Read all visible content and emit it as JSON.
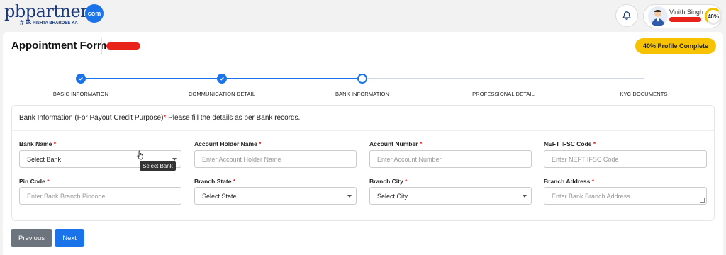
{
  "topbar": {
    "logo_text": "pbpartners",
    "logo_com": "com",
    "logo_tagline": "EK RISHTA BHAROSE KA",
    "user_name": "Vinith Singh",
    "profile_percent": "40%"
  },
  "header": {
    "title": "Appointment Form",
    "profile_complete": "40% Profile Complete"
  },
  "stepper": {
    "steps": [
      {
        "label": "BASIC INFORMATION",
        "state": "done"
      },
      {
        "label": "COMMUNICATION DETAIL",
        "state": "done"
      },
      {
        "label": "BANK INFORMATION",
        "state": "current"
      },
      {
        "label": "PROFESSIONAL DETAIL",
        "state": "pending"
      },
      {
        "label": "KYC DOCUMENTS",
        "state": "pending"
      }
    ]
  },
  "section": {
    "title": "Bank Information (For Payout Credit Purpose)",
    "required_mark": "*",
    "note": " Please fill the details as per Bank records."
  },
  "fields": {
    "bank_name": {
      "label": "Bank Name",
      "value": "Select Bank"
    },
    "account_holder": {
      "label": "Account Holder Name",
      "placeholder": "Enter Account Holder Name"
    },
    "account_number": {
      "label": "Account Number",
      "placeholder": "Enter Account Number"
    },
    "ifsc": {
      "label": "NEFT IFSC Code",
      "placeholder": "Enter NEFT IFSC Code"
    },
    "pin_code": {
      "label": "Pin Code",
      "placeholder": "Enter Bank Branch Pincode"
    },
    "branch_state": {
      "label": "Branch State",
      "value": "Select State"
    },
    "branch_city": {
      "label": "Branch City",
      "value": "Select City"
    },
    "branch_address": {
      "label": "Branch Address",
      "placeholder": "Enter Bank Branch Address"
    }
  },
  "tooltip": "Select Bank",
  "buttons": {
    "previous": "Previous",
    "next": "Next"
  },
  "colors": {
    "accent": "#1a73e8",
    "badge": "#f7c300",
    "required": "#e21b1b",
    "redaction": "#e8231a"
  }
}
